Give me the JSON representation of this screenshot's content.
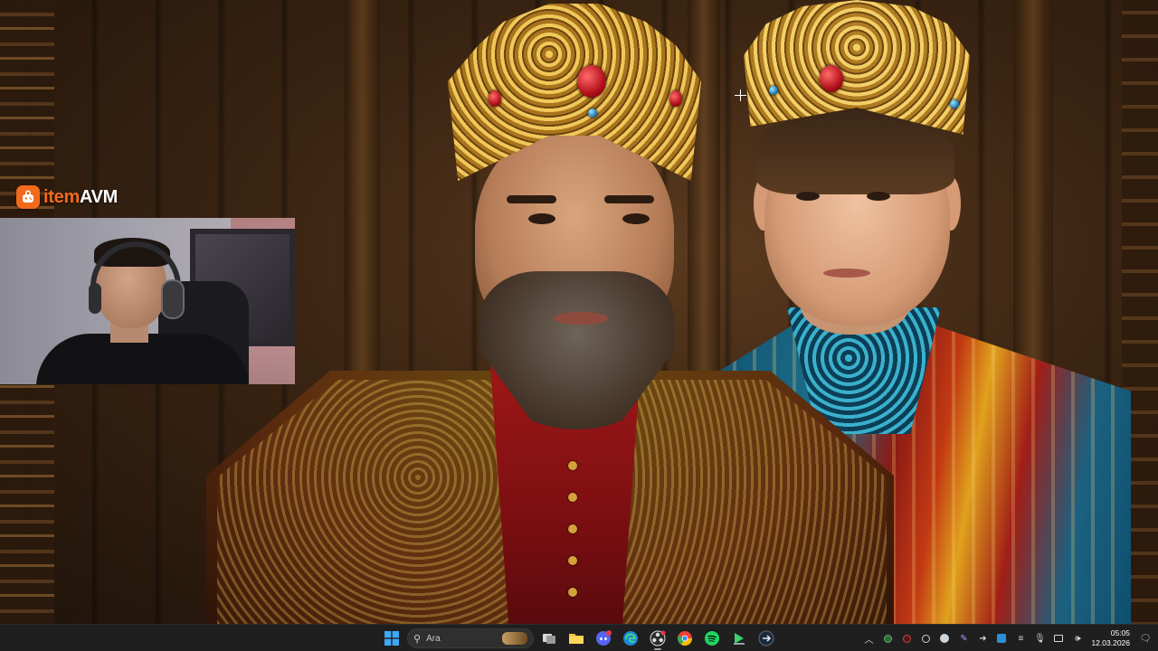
{
  "overlay": {
    "logo": {
      "part1": "item",
      "part2": "AVM",
      "brand_color": "#f26a1b"
    }
  },
  "taskbar": {
    "search_placeholder": "Ara",
    "pinned": [
      {
        "name": "task-view-icon"
      },
      {
        "name": "file-explorer-icon"
      },
      {
        "name": "discord-icon"
      },
      {
        "name": "edge-icon"
      },
      {
        "name": "obs-icon"
      },
      {
        "name": "chrome-icon"
      },
      {
        "name": "spotify-icon"
      },
      {
        "name": "media-player-icon"
      },
      {
        "name": "app-arrow-icon"
      }
    ],
    "clock": {
      "time": "05:05",
      "date": "12.03.2026"
    }
  },
  "colors": {
    "taskbar_bg": "#1f1f1f",
    "accent_orange": "#f26a1b"
  }
}
